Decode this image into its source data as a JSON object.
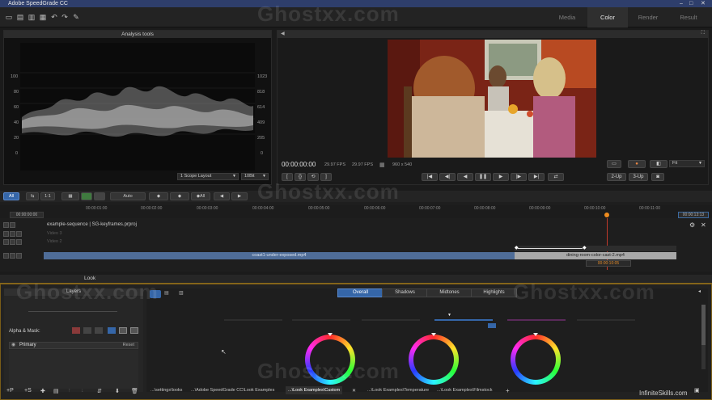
{
  "app": {
    "title": "Adobe SpeedGrade CC"
  },
  "main_tabs": [
    {
      "label": "Media",
      "active": false
    },
    {
      "label": "Color",
      "active": true
    },
    {
      "label": "Render",
      "active": false
    },
    {
      "label": "Result",
      "active": false
    }
  ],
  "analysis": {
    "header": "Analysis tools",
    "left_scale": [
      "100",
      "80",
      "60",
      "40",
      "20",
      "0"
    ],
    "right_scale": [
      "1023",
      "818",
      "614",
      "409",
      "205",
      "0"
    ],
    "layout_select": "1 Scope Layout",
    "bits_select": "10Bit"
  },
  "viewer": {
    "timecode": "00:00:00:00",
    "fps1": "29.97 FPS",
    "fps2": "29.97 FPS",
    "resolution": "960 x 540",
    "fit_select": "Fit",
    "btn_2up": "2-Up",
    "btn_3up": "3-Up"
  },
  "timeline": {
    "filter_all": "All",
    "auto_label": "Auto",
    "all_label": "All",
    "timecode_start": "00:00:00:00",
    "timecode_end": "00:00:13:13",
    "ruler": [
      "00:00:01:00",
      "00:00:02:00",
      "00:00:03:00",
      "00:00:04:00",
      "00:00:05:00",
      "00:00:06:00",
      "00:00:07:00",
      "00:00:08:00",
      "00:00:09:00",
      "00:00:10:00",
      "00:00:11:00"
    ],
    "sequence": "example-sequence | SG-keyframes.prproj",
    "video_tracks": [
      "Video 3",
      "Video 2"
    ],
    "clip1": "coast1-under-exposed.mp4",
    "clip2": "dining-room-color-cast-2.mp4",
    "clip2_time": "00:00:10:05"
  },
  "look": {
    "tab": "Look",
    "layers_header": "Layers",
    "alpha_mask": "Alpha & Mask:",
    "primary": "Primary",
    "reset": "Reset",
    "grade_tabs": [
      "Overall",
      "Shadows",
      "Midtones",
      "Highlights"
    ],
    "presets": [
      "...\\settings\\looks",
      "...\\Adobe SpeedGrade CC\\Look Examples",
      "...\\Look Examples\\Custom",
      "...\\Look Examples\\Temperature",
      "...\\Look Examples\\Filmstock"
    ]
  },
  "watermark": {
    "site": "Ghostxx.com",
    "brand": "InfiniteSkills.com"
  }
}
